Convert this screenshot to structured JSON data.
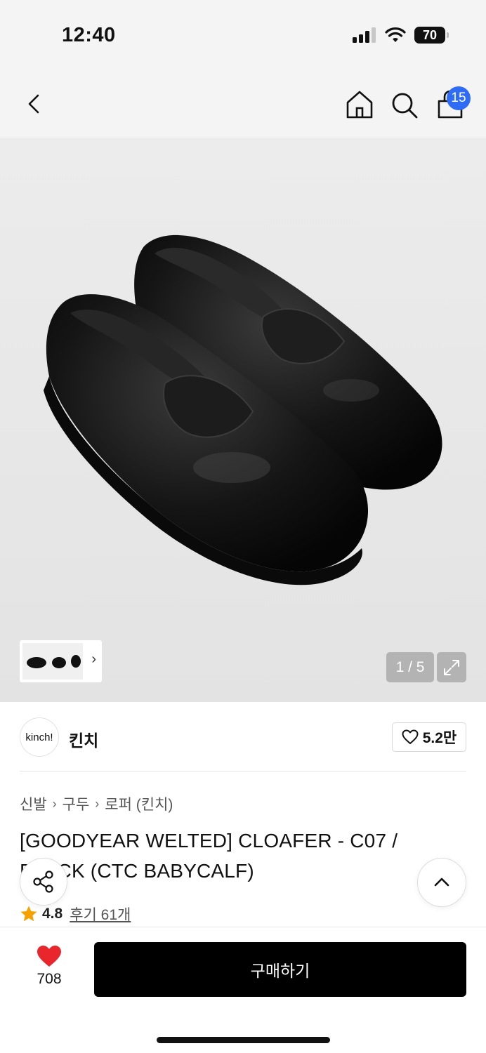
{
  "status": {
    "time": "12:40",
    "battery": "70",
    "icons": [
      "signal-icon",
      "wifi-icon",
      "battery-icon"
    ]
  },
  "nav": {
    "icons": [
      "back-icon",
      "home-icon",
      "search-icon",
      "cart-icon"
    ],
    "cart_badge": "15"
  },
  "gallery": {
    "counter": "1 / 5",
    "thumbnail_arrow": "›",
    "expand_icon": "expand-icon"
  },
  "brand": {
    "logo_text": "kinch!",
    "name": "킨치",
    "likes": "5.2만"
  },
  "breadcrumb": {
    "items": [
      "신발",
      "구두",
      "로퍼 (킨치)"
    ],
    "separator": "›"
  },
  "product": {
    "title": "[GOODYEAR WELTED] CLOAFER - C07 / BLACK (CTC BABYCALF)",
    "rating": "4.8",
    "reviews": "후기 61개"
  },
  "bottom": {
    "wish_count": "708",
    "buy_label": "구매하기"
  },
  "colors": {
    "badge": "#2f6cf5",
    "heart": "#e8262b",
    "star": "#f5a200",
    "buy_button": "#000000"
  }
}
